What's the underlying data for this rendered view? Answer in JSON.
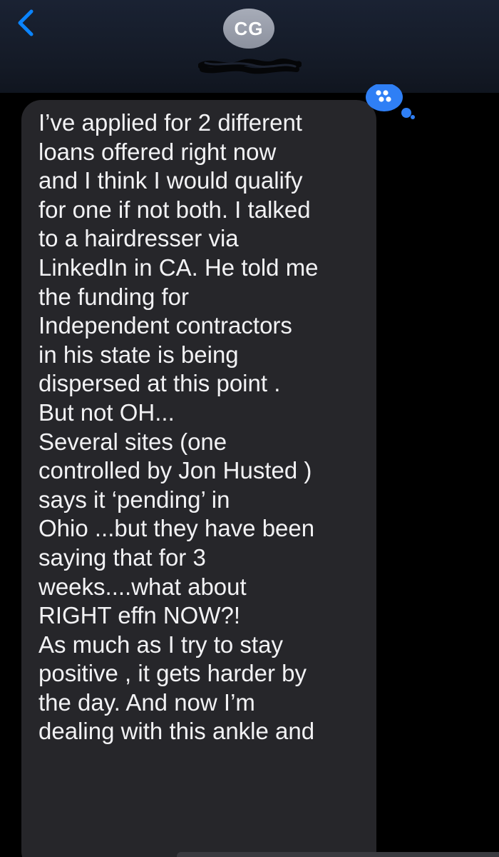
{
  "header": {
    "avatar_initials": "CG",
    "back_icon": "chevron-left-icon",
    "accent_color": "#0a84ff"
  },
  "message": {
    "lines": [
      "I’ve applied for 2 different",
      "loans offered right now",
      "and I think I would qualify",
      "for one if not both. I talked",
      "to a hairdresser via",
      "LinkedIn in CA. He told me",
      "the funding for",
      "Independent contractors",
      "in his state is being",
      "dispersed at this point .",
      "But not OH...",
      "Several sites (one",
      "controlled by Jon Husted )",
      "says it ‘pending’ in",
      "Ohio ...but they have been",
      "saying that for 3",
      "weeks....what about",
      "RIGHT effn NOW?!",
      "As much as I try to stay",
      "positive , it gets harder by",
      "the day. And now I’m",
      "dealing with this ankle and"
    ],
    "bubble_color": "#26262a",
    "text_color": "#f2f2f4"
  }
}
